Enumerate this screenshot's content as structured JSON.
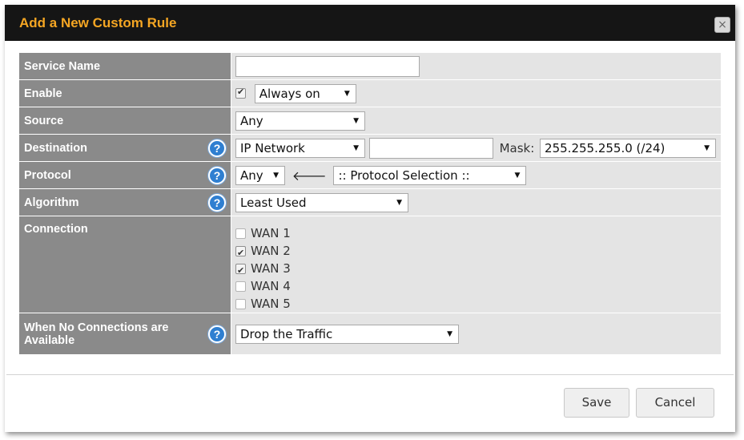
{
  "dialog": {
    "title": "Add a New Custom Rule",
    "close_label": "×"
  },
  "form": {
    "service_name": {
      "label": "Service Name",
      "value": ""
    },
    "enable": {
      "label": "Enable",
      "checked": true,
      "select": "Always on"
    },
    "source": {
      "label": "Source",
      "select": "Any"
    },
    "destination": {
      "label": "Destination",
      "select": "IP Network",
      "value": "",
      "mask_label": "Mask:",
      "mask_select": "255.255.255.0 (/24)"
    },
    "protocol": {
      "label": "Protocol",
      "select": "Any",
      "protocol_selection": ":: Protocol Selection ::"
    },
    "algorithm": {
      "label": "Algorithm",
      "select": "Least Used"
    },
    "connection": {
      "label": "Connection",
      "wans": [
        {
          "label": "WAN 1",
          "checked": false
        },
        {
          "label": "WAN 2",
          "checked": true
        },
        {
          "label": "WAN 3",
          "checked": true
        },
        {
          "label": "WAN 4",
          "checked": false
        },
        {
          "label": "WAN 5",
          "checked": false
        }
      ]
    },
    "no_connections": {
      "label": "When No Connections are Available",
      "select": "Drop the Traffic"
    },
    "help_glyph": "?"
  },
  "buttons": {
    "save": "Save",
    "cancel": "Cancel"
  },
  "colors": {
    "title": "#f5a623",
    "label_bg": "#8a8a8a",
    "value_bg": "#e4e4e4",
    "help": "#2f7fd1"
  },
  "icons": {
    "dropdown": "chevron-down-icon",
    "protocol_arrow": "arrow-left-icon",
    "help": "help-icon",
    "close": "close-icon"
  }
}
